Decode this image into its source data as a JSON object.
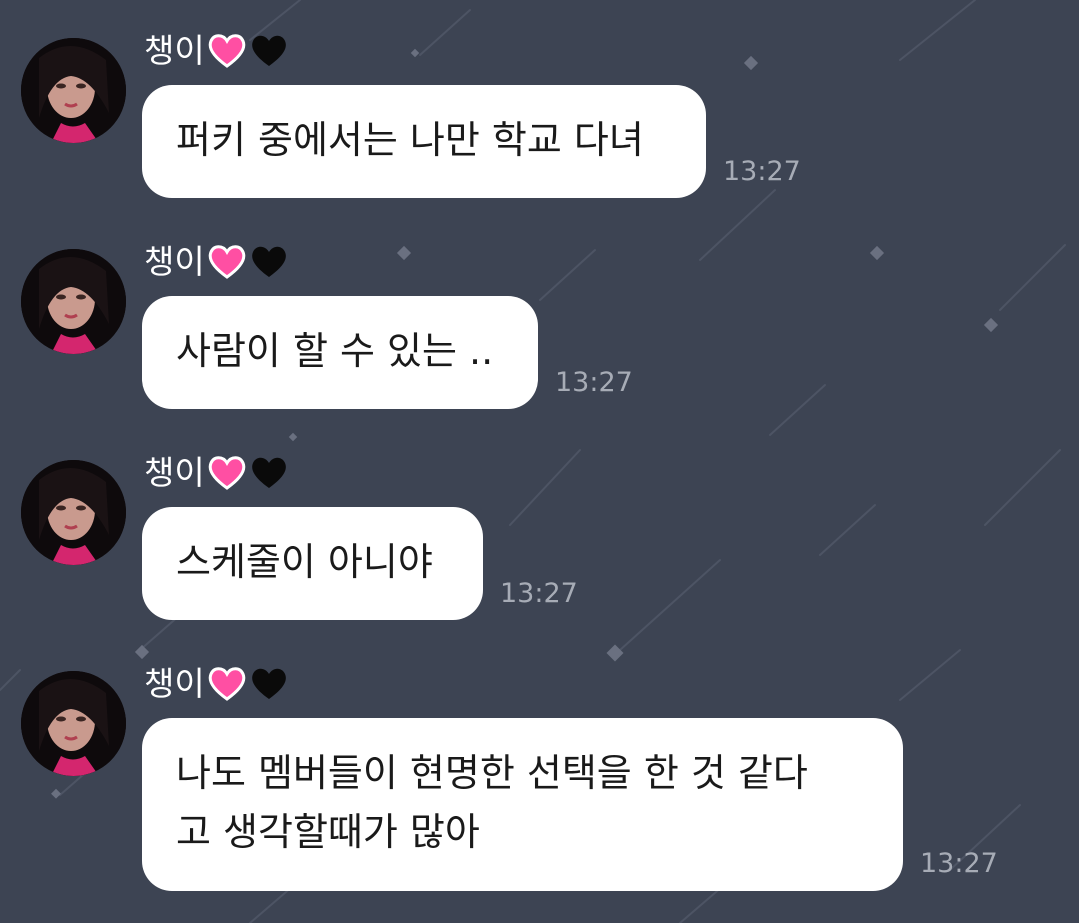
{
  "chat": {
    "background_color": "#3d4453",
    "bubble_color": "#ffffff",
    "messages": [
      {
        "sender": "챙이",
        "text": "퍼키 중에서는 나만 학교 다녀",
        "time": "13:27",
        "avatar": "profile-photo"
      },
      {
        "sender": "챙이",
        "text": "사람이 할 수 있는 ..",
        "time": "13:27",
        "avatar": "profile-photo"
      },
      {
        "sender": "챙이",
        "text": "스케줄이 아니야",
        "time": "13:27",
        "avatar": "profile-photo"
      },
      {
        "sender": "챙이",
        "text": "나도 멤버들이 현명한 선택을 한 것 같다\n고 생각할때가 많아",
        "time": "13:27",
        "avatar": "profile-photo"
      }
    ],
    "sender_emoji": [
      "pink-heart-icon",
      "black-heart-icon"
    ]
  }
}
